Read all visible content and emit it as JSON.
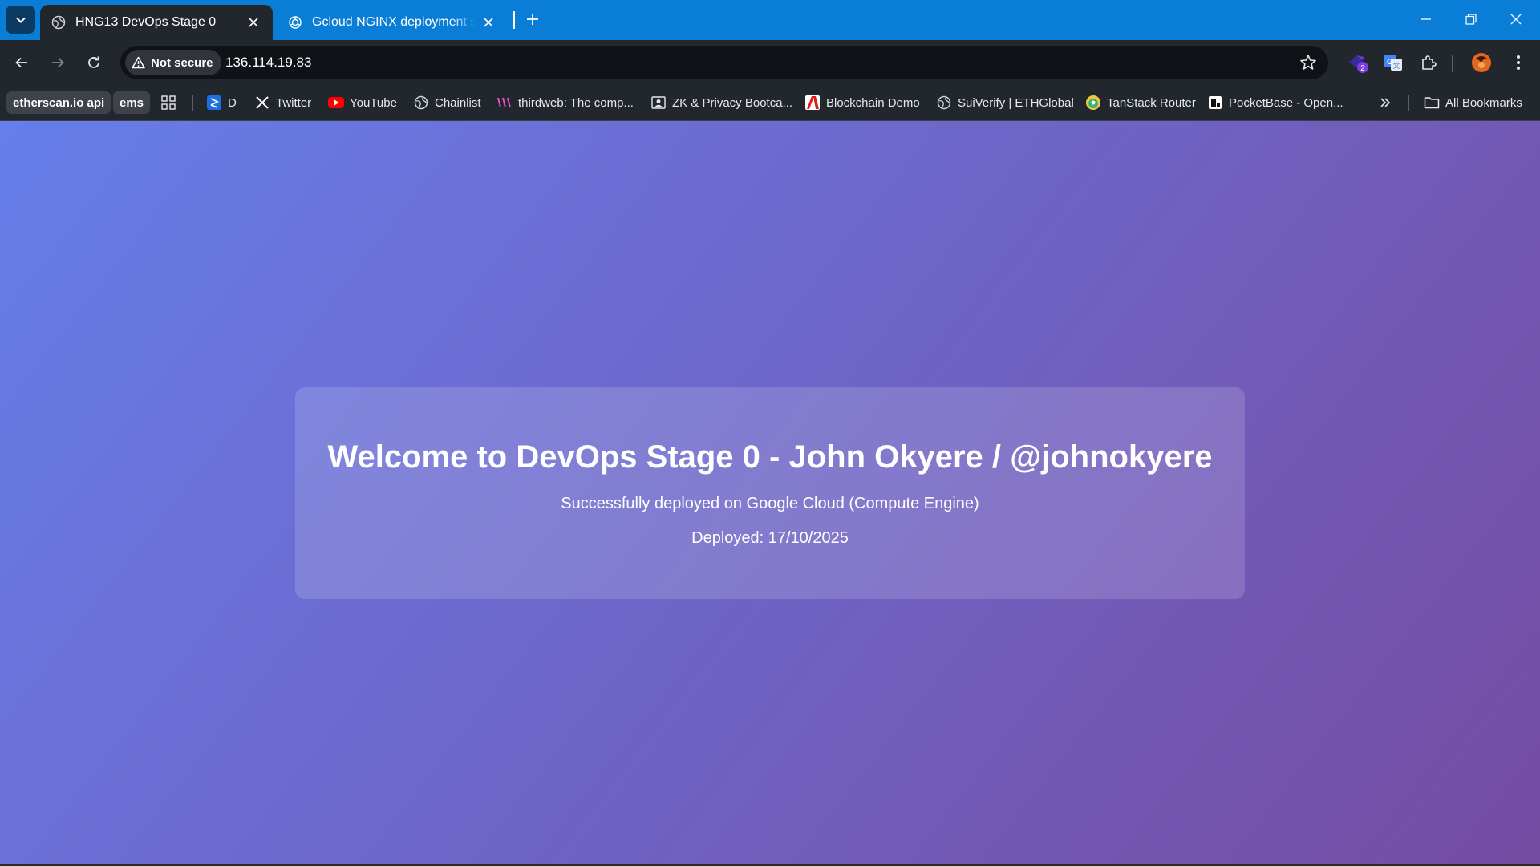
{
  "browser": {
    "tabs": [
      {
        "title": "HNG13 DevOps Stage 0",
        "active": true,
        "favicon": "globe-icon"
      },
      {
        "title": "Gcloud NGINX deployment steps",
        "active": false,
        "favicon": "chatgpt-icon"
      }
    ],
    "omnibox": {
      "security_label": "Not secure",
      "url": "136.114.19.83"
    },
    "extensions_badge": "2",
    "bookmarks": [
      {
        "label": "etherscan.io api",
        "style": "chip"
      },
      {
        "label": "ems",
        "style": "chip"
      },
      {
        "label": "D",
        "icon": "d-icon"
      },
      {
        "label": "Twitter",
        "icon": "x-logo-icon"
      },
      {
        "label": "YouTube",
        "icon": "youtube-icon"
      },
      {
        "label": "Chainlist",
        "icon": "globe-icon"
      },
      {
        "label": "thirdweb: The comp...",
        "icon": "thirdweb-icon"
      },
      {
        "label": "ZK & Privacy Bootca...",
        "icon": "contact-icon"
      },
      {
        "label": "Blockchain Demo",
        "icon": "adobe-icon"
      },
      {
        "label": "SuiVerify | ETHGlobal",
        "icon": "globe-icon"
      },
      {
        "label": "TanStack Router",
        "icon": "tanstack-icon"
      },
      {
        "label": "PocketBase - Open...",
        "icon": "pocketbase-icon"
      }
    ],
    "all_bookmarks_label": "All Bookmarks"
  },
  "page": {
    "heading": "Welcome to DevOps Stage 0 - John Okyere / @johnokyere",
    "subtitle": "Successfully deployed on Google Cloud (Compute Engine)",
    "deployed": "Deployed: 17/10/2025",
    "gradient_start": "#667eea",
    "gradient_end": "#764ba2"
  }
}
